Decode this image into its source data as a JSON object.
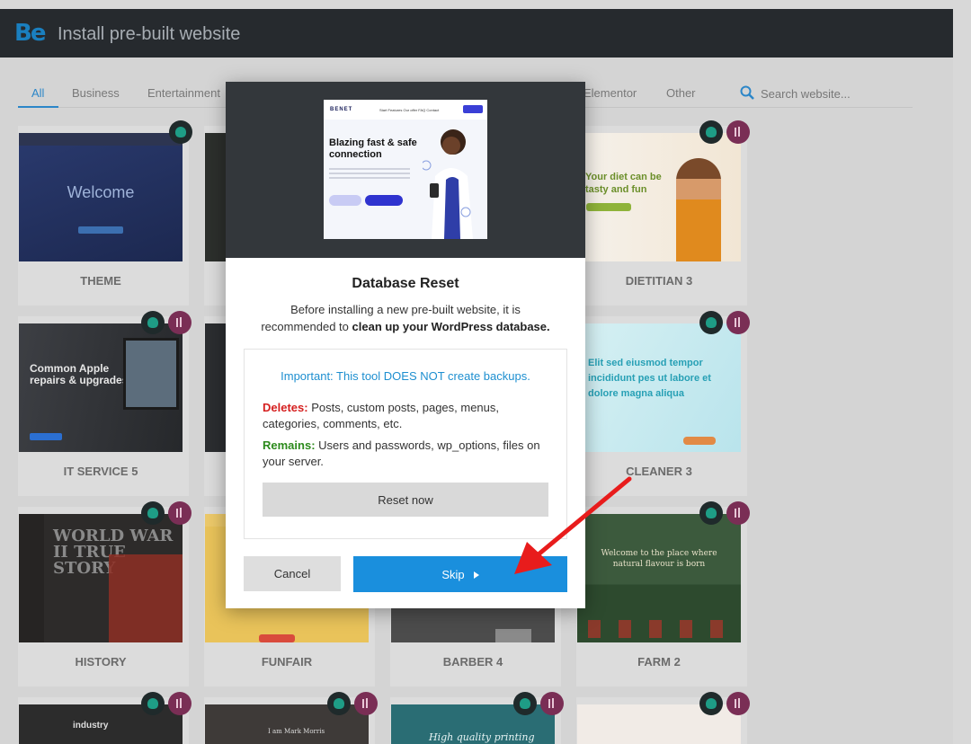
{
  "header": {
    "logo": "Be",
    "title": "Install pre-built website"
  },
  "filters": {
    "items": [
      "All",
      "Business",
      "Entertainment",
      "Elementor",
      "Other"
    ],
    "active": "All"
  },
  "search": {
    "placeholder": "Search website..."
  },
  "cards": [
    {
      "label": "THEME",
      "preview_text": "Welcome"
    },
    {
      "label": "DIETITIAN 3",
      "preview_text": "Your diet can be tasty and fun"
    },
    {
      "label": "IT SERVICE 5",
      "preview_text": "Common Apple repairs & upgrades"
    },
    {
      "label": "CLEANER 3",
      "preview_text": "Elit sed eiusmod tempor incididunt pes ut labore et dolore magna aliqua"
    },
    {
      "label": "HISTORY",
      "preview_text": "WORLD WAR II TRUE STORY"
    },
    {
      "label": "FUNFAIR"
    },
    {
      "label": "BARBER 4"
    },
    {
      "label": "FARM 2",
      "preview_text": "Welcome to the place where natural flavour is born"
    }
  ],
  "bottom_cards": [
    {
      "preview_text": "industry"
    },
    {
      "preview_text": "I am Mark Morris"
    },
    {
      "preview_text": "High quality printing"
    },
    {
      "preview_text": ""
    }
  ],
  "modal": {
    "preview": {
      "logo": "BENET",
      "nav": "Start   Features   Our offer   FAQ   Contact",
      "headline": "Blazing fast & safe connection"
    },
    "title": "Database Reset",
    "desc_plain": "Before installing a new pre-built website, it is recommended to ",
    "desc_bold": "clean up your WordPress database.",
    "important": "Important: This tool DOES NOT create backups.",
    "deletes_label": "Deletes:",
    "deletes_text": " Posts, custom posts, pages, menus, categories, comments, etc.",
    "remains_label": "Remains:",
    "remains_text": " Users and passwords, wp_options, files on your server.",
    "reset_button": "Reset now",
    "cancel_button": "Cancel",
    "skip_button": "Skip"
  },
  "colors": {
    "accent": "#1a8fdd",
    "deletes": "#d51f1f",
    "remains": "#2c8a1c",
    "annotation_arrow": "#e81c1c"
  }
}
